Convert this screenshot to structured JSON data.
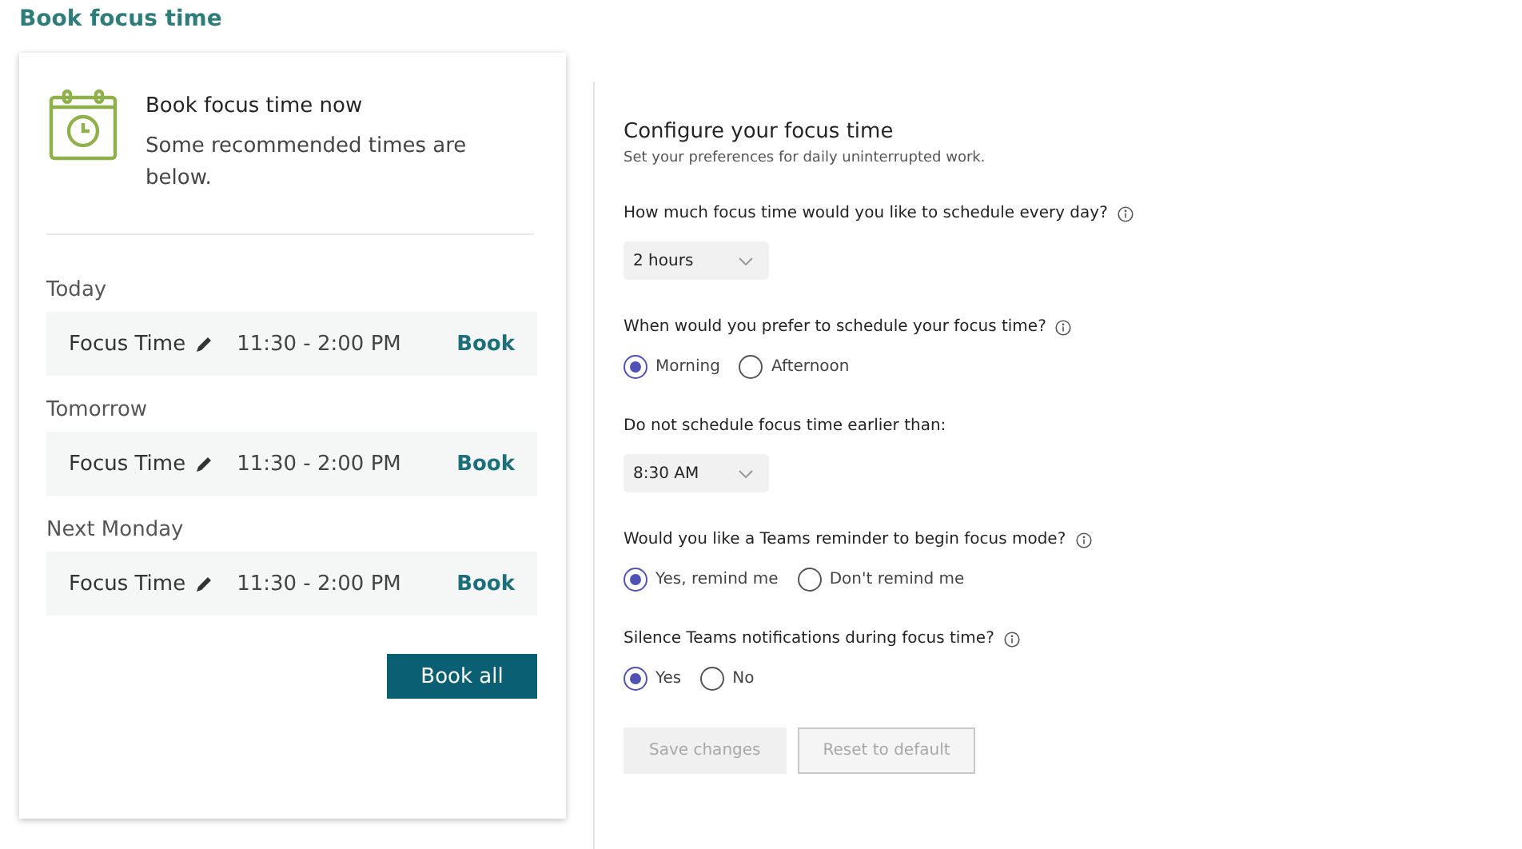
{
  "page_title": "Book focus time",
  "card": {
    "title": "Book focus time now",
    "subtitle": "Some recommended times are below.",
    "days": [
      {
        "label": "Today",
        "slot": {
          "name": "Focus Time",
          "time": "11:30 - 2:00 PM",
          "action": "Book"
        }
      },
      {
        "label": "Tomorrow",
        "slot": {
          "name": "Focus Time",
          "time": "11:30 - 2:00 PM",
          "action": "Book"
        }
      },
      {
        "label": "Next Monday",
        "slot": {
          "name": "Focus Time",
          "time": "11:30 - 2:00 PM",
          "action": "Book"
        }
      }
    ],
    "book_all": "Book all"
  },
  "settings": {
    "title": "Configure your focus time",
    "subtitle": "Set your preferences for daily uninterrupted work.",
    "questions": [
      {
        "kind": "select",
        "label": "How much focus time would you like to schedule every day?",
        "info": true,
        "value": "2 hours"
      },
      {
        "kind": "radio",
        "label": "When would you prefer to schedule your focus time?",
        "info": true,
        "options": [
          {
            "label": "Morning",
            "selected": true
          },
          {
            "label": "Afternoon",
            "selected": false
          }
        ]
      },
      {
        "kind": "select",
        "label": "Do not schedule focus time earlier than:",
        "info": false,
        "value": "8:30 AM"
      },
      {
        "kind": "radio",
        "label": "Would you like a Teams reminder to begin focus mode?",
        "info": true,
        "options": [
          {
            "label": "Yes, remind me",
            "selected": true
          },
          {
            "label": "Don't remind me",
            "selected": false
          }
        ]
      },
      {
        "kind": "radio",
        "label": "Silence Teams notifications during focus time?",
        "info": true,
        "options": [
          {
            "label": "Yes",
            "selected": true
          },
          {
            "label": "No",
            "selected": false
          }
        ]
      }
    ],
    "buttons": [
      {
        "label": "Save changes",
        "disabled": true
      },
      {
        "label": "Reset to default",
        "disabled": false
      }
    ]
  }
}
